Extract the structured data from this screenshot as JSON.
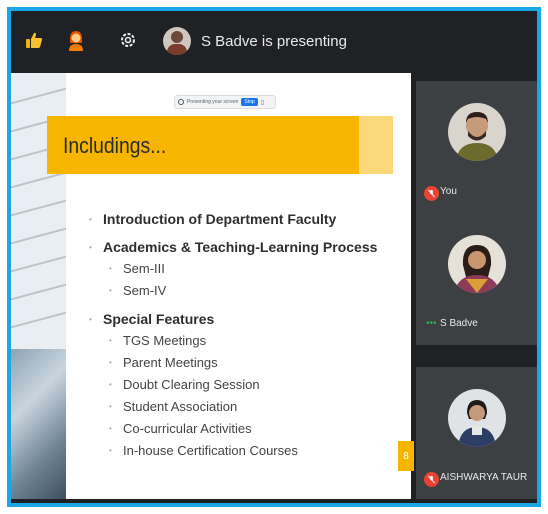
{
  "top_bar": {
    "presenting_text": "S Badve is presenting",
    "icons": [
      "thumbs-up-icon",
      "person-emoji-icon",
      "settings-icon"
    ]
  },
  "slide": {
    "search_bar_text": "Presenting your screen",
    "search_button": "Stop",
    "title": "Includings...",
    "items": [
      {
        "level": 1,
        "text": "Introduction of Department Faculty"
      },
      {
        "level": 1,
        "text": "Academics & Teaching-Learning Process"
      },
      {
        "level": 2,
        "text": "Sem-III"
      },
      {
        "level": 2,
        "text": "Sem-IV"
      },
      {
        "level": 1,
        "text": "Special Features"
      },
      {
        "level": 2,
        "text": "TGS Meetings"
      },
      {
        "level": 2,
        "text": "Parent Meetings"
      },
      {
        "level": 2,
        "text": "Doubt Clearing Session"
      },
      {
        "level": 2,
        "text": "Student Association"
      },
      {
        "level": 2,
        "text": "Co-curricular Activities"
      },
      {
        "level": 2,
        "text": "In-house Certification Courses"
      }
    ],
    "page_number": "8"
  },
  "participants": [
    {
      "name": "You",
      "muted": true
    },
    {
      "name": "S Badve",
      "muted": false,
      "speaking": true
    },
    {
      "name": "AISHWARYA TAUR",
      "muted": true
    }
  ],
  "colors": {
    "frame_border": "#1aa7e6",
    "meet_dark": "#202124",
    "tile_bg": "#3c4043",
    "accent_yellow": "#f7b500",
    "mic_muted": "#ea4335"
  }
}
